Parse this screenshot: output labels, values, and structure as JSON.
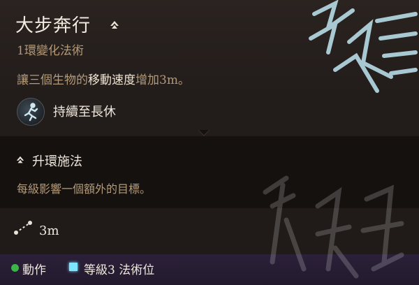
{
  "spell": {
    "title": "大步奔行",
    "subtitle": "1環變化法術",
    "desc_prefix": "讓三個生物的",
    "desc_highlight": "移動速度",
    "desc_suffix": "增加3m。",
    "duration": "持續至長休"
  },
  "upcast": {
    "title": "升環施法",
    "description": "每級影響一個額外的目標。"
  },
  "range": {
    "value": "3m"
  },
  "footer": {
    "action": "動作",
    "slot": "等級3 法術位"
  },
  "colors": {
    "action_dot": "#39b54a",
    "slot_square": "#7fe6ff",
    "highlight_text": "#f1e6d4",
    "muted_text": "#b49a78"
  }
}
